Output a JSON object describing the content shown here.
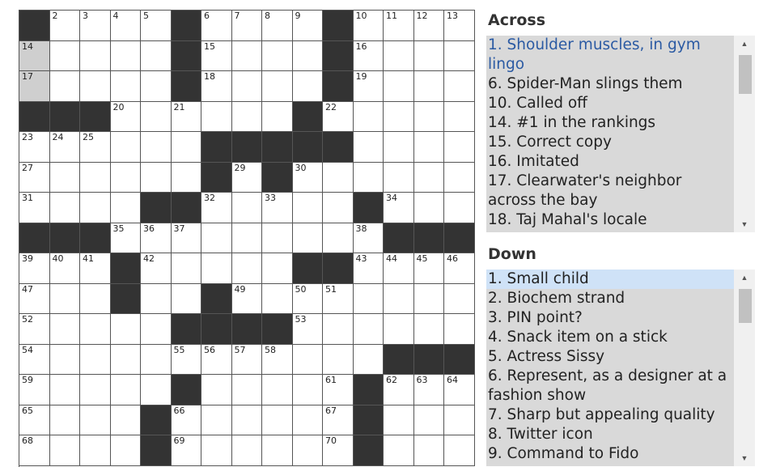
{
  "puzzle": {
    "rows": [
      "#....#....#....",
      ".....#....#....",
      ".....#....#....",
      "###......#.....",
      "......#####....",
      "......#.#......",
      "....##.....#...",
      "###.........###",
      "...#.....##....",
      "...#..#........",
      ".....####......",
      "............###",
      ".....#.....#...",
      "....#......#...",
      "....#......#..."
    ],
    "numbers": [
      [
        1,
        0,
        0
      ],
      [
        2,
        0,
        1
      ],
      [
        3,
        0,
        2
      ],
      [
        4,
        0,
        3
      ],
      [
        5,
        0,
        4
      ],
      [
        6,
        0,
        6
      ],
      [
        7,
        0,
        7
      ],
      [
        8,
        0,
        8
      ],
      [
        9,
        0,
        9
      ],
      [
        10,
        0,
        11
      ],
      [
        11,
        0,
        12
      ],
      [
        12,
        0,
        13
      ],
      [
        13,
        0,
        14
      ],
      [
        14,
        1,
        0
      ],
      [
        15,
        1,
        6
      ],
      [
        16,
        1,
        11
      ],
      [
        17,
        2,
        0
      ],
      [
        18,
        2,
        6
      ],
      [
        19,
        2,
        11
      ],
      [
        20,
        3,
        3
      ],
      [
        21,
        3,
        5
      ],
      [
        22,
        3,
        10
      ],
      [
        23,
        4,
        0
      ],
      [
        24,
        4,
        1
      ],
      [
        25,
        4,
        2
      ],
      [
        26,
        4,
        10
      ],
      [
        27,
        5,
        0
      ],
      [
        28,
        5,
        6
      ],
      [
        29,
        5,
        7
      ],
      [
        30,
        5,
        9
      ],
      [
        31,
        6,
        0
      ],
      [
        32,
        6,
        6
      ],
      [
        33,
        6,
        8
      ],
      [
        34,
        6,
        12
      ],
      [
        35,
        7,
        3
      ],
      [
        36,
        7,
        4
      ],
      [
        37,
        7,
        5
      ],
      [
        38,
        7,
        11
      ],
      [
        39,
        8,
        0
      ],
      [
        40,
        8,
        1
      ],
      [
        41,
        8,
        2
      ],
      [
        42,
        8,
        4
      ],
      [
        43,
        8,
        11
      ],
      [
        44,
        8,
        12
      ],
      [
        45,
        8,
        13
      ],
      [
        46,
        8,
        14
      ],
      [
        47,
        9,
        0
      ],
      [
        48,
        9,
        3
      ],
      [
        49,
        9,
        7
      ],
      [
        50,
        9,
        9
      ],
      [
        51,
        9,
        10
      ],
      [
        52,
        10,
        0
      ],
      [
        53,
        10,
        9
      ],
      [
        54,
        11,
        0
      ],
      [
        55,
        11,
        5
      ],
      [
        56,
        11,
        6
      ],
      [
        57,
        11,
        7
      ],
      [
        58,
        11,
        8
      ],
      [
        59,
        12,
        0
      ],
      [
        60,
        12,
        5
      ],
      [
        61,
        12,
        10
      ],
      [
        62,
        12,
        12
      ],
      [
        63,
        12,
        13
      ],
      [
        64,
        12,
        14
      ],
      [
        65,
        13,
        0
      ],
      [
        66,
        13,
        5
      ],
      [
        67,
        13,
        10
      ],
      [
        68,
        14,
        0
      ],
      [
        69,
        14,
        5
      ],
      [
        70,
        14,
        10
      ]
    ],
    "selected_cell": [
      0,
      0
    ],
    "highlighted_cells": [
      [
        1,
        0
      ],
      [
        2,
        0
      ]
    ]
  },
  "across": {
    "title": "Across",
    "clues": [
      "1. Shoulder muscles, in gym lingo",
      "6. Spider-Man slings them",
      "10. Called off",
      "14. #1 in the rankings",
      "15. Correct copy",
      "16. Imitated",
      "17. Clearwater's neighbor across the bay",
      "18. Taj Mahal's locale"
    ],
    "active_index": 0
  },
  "down": {
    "title": "Down",
    "clues": [
      "1. Small child",
      "2. Biochem strand",
      "3. PIN point?",
      "4. Snack item on a stick",
      "5. Actress Sissy",
      "6. Represent, as a designer at a fashion show",
      "7. Sharp but appealing quality",
      "8. Twitter icon",
      "9. Command to Fido"
    ],
    "current_index": 0
  },
  "icons": {
    "scroll_up": "▲",
    "scroll_down": "▼",
    "scroll_up_name": "scroll-up-arrow-icon",
    "scroll_down_name": "scroll-down-arrow-icon"
  },
  "colors": {
    "block": "#333333",
    "selected": "#c8dcf2",
    "highlighted": "#cfcfcf",
    "active_clue_text": "#2b5aa3",
    "current_clue_bg": "#cfe2f7"
  }
}
